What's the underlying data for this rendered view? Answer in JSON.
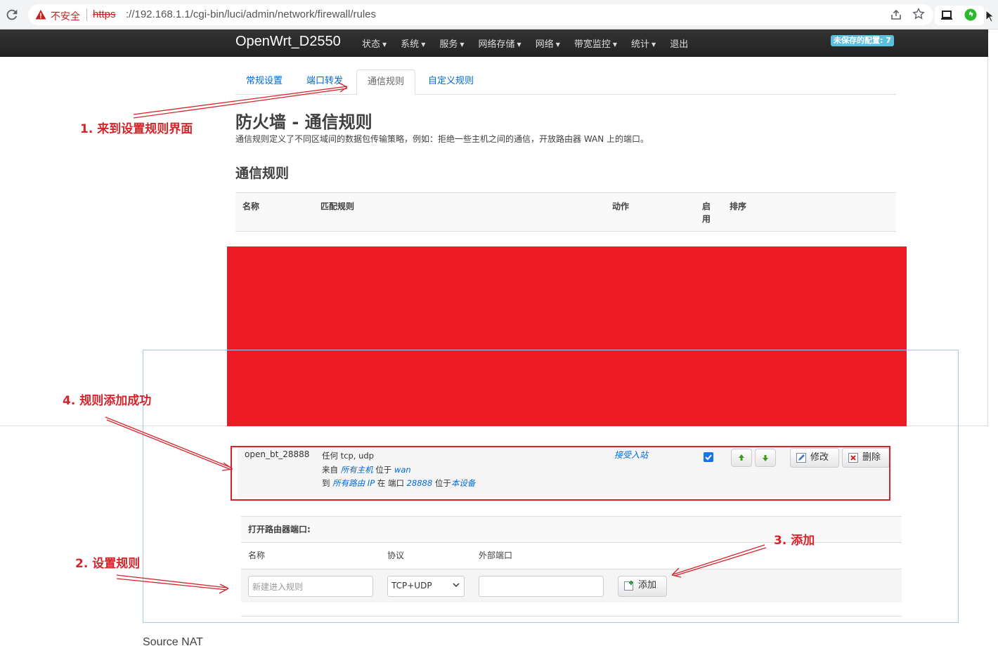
{
  "browser": {
    "insecure_label": "不安全",
    "url_scheme": "https",
    "url_rest": "://192.168.1.1/cgi-bin/luci/admin/network/firewall/rules"
  },
  "navbar": {
    "brand": "OpenWrt_D2550",
    "items": [
      "状态",
      "系统",
      "服务",
      "网络存储",
      "网络",
      "带宽监控",
      "统计",
      "退出"
    ],
    "unsaved_badge": "未保存的配置: 7"
  },
  "tabs": [
    "常规设置",
    "端口转发",
    "通信规则",
    "自定义规则"
  ],
  "active_tab": "通信规则",
  "page": {
    "title": "防火墙 - 通信规则",
    "description": "通信规则定义了不同区域间的数据包传输策略，例如：拒绝一些主机之间的通信，开放路由器 WAN 上的端口。",
    "section_title": "通信规则"
  },
  "rules_table": {
    "headers": {
      "name": "名称",
      "match": "匹配规则",
      "action": "动作",
      "enable_1": "启",
      "enable_2": "用",
      "sort": "排序"
    }
  },
  "rule": {
    "name": "open_bt_28888",
    "line1": "任何 tcp, udp",
    "line2_prefix": "来自",
    "line2_host": "所有主机",
    "line2_mid": "位于",
    "line2_zone": "wan",
    "line3_prefix": "到",
    "line3_ip": "所有路由 IP",
    "line3_mid": "在 端口",
    "line3_port": "28888",
    "line3_mid2": "位于",
    "line3_device": "本设备",
    "action": "接受入站",
    "enabled": true,
    "edit_label": "修改",
    "delete_label": "删除"
  },
  "open_ports": {
    "title": "打开路由器端口:",
    "col_name": "名称",
    "col_protocol": "协议",
    "col_port": "外部端口",
    "name_placeholder": "新建进入规则",
    "protocol_value": "TCP+UDP",
    "port_value": "",
    "add_label": "添加"
  },
  "next_section": "Source NAT",
  "annotations": {
    "step1": "1. 来到设置规则界面",
    "step2": "2. 设置规则",
    "step3": "3. 添加",
    "step4": "4. 规则添加成功"
  },
  "colors": {
    "annotation_red": "#d7242b",
    "redaction_red": "#ed1c24",
    "link_blue": "#0069d6",
    "navbar_dark": "#222222",
    "badge_blue": "#5bc0de"
  }
}
